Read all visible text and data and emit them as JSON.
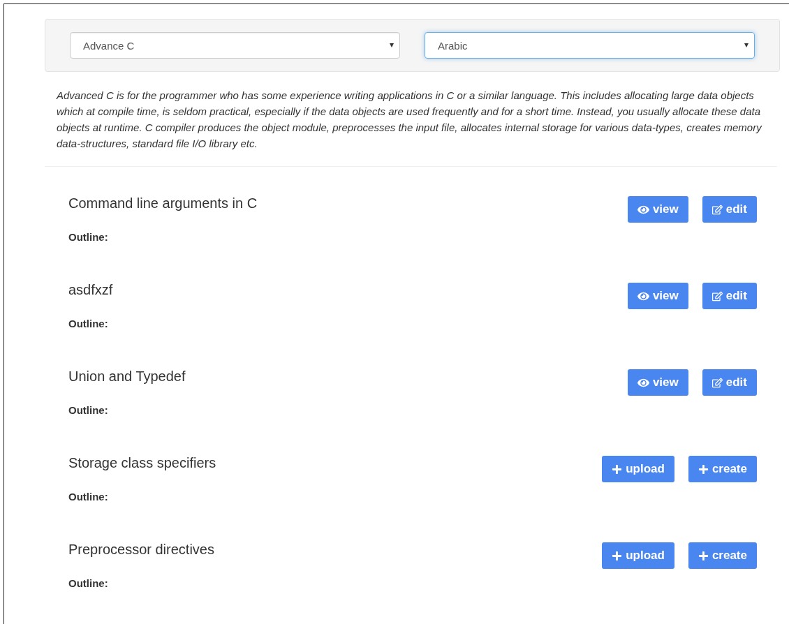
{
  "selects": [
    {
      "value": "Advance C",
      "focused": false
    },
    {
      "value": "Arabic",
      "focused": true
    }
  ],
  "description": "Advanced C is for the programmer who has some experience writing applications in C or a similar language.  This includes allocating large data objects which at compile time, is seldom practical, especially if the data objects are used frequently and for a short time.  Instead, you usually allocate these data objects at runtime.  C compiler produces the object module, preprocesses the input file, allocates internal storage for various data-types, creates memory data-structures, standard file I/O library etc.",
  "lessons": [
    {
      "title": "Command line arguments in C",
      "outline": "Outline:",
      "actions": [
        {
          "kind": "view",
          "label": "view"
        },
        {
          "kind": "edit",
          "label": "edit"
        }
      ]
    },
    {
      "title": "asdfxzf",
      "outline": "Outline:",
      "actions": [
        {
          "kind": "view",
          "label": "view"
        },
        {
          "kind": "edit",
          "label": "edit"
        }
      ]
    },
    {
      "title": "Union and Typedef",
      "outline": "Outline:",
      "actions": [
        {
          "kind": "view",
          "label": "view"
        },
        {
          "kind": "edit",
          "label": "edit"
        }
      ]
    },
    {
      "title": "Storage class specifiers",
      "outline": "Outline:",
      "actions": [
        {
          "kind": "upload",
          "label": "upload"
        },
        {
          "kind": "create",
          "label": "create"
        }
      ]
    },
    {
      "title": "Preprocessor directives",
      "outline": "Outline:",
      "actions": [
        {
          "kind": "upload",
          "label": "upload"
        },
        {
          "kind": "create",
          "label": "create"
        }
      ]
    }
  ]
}
